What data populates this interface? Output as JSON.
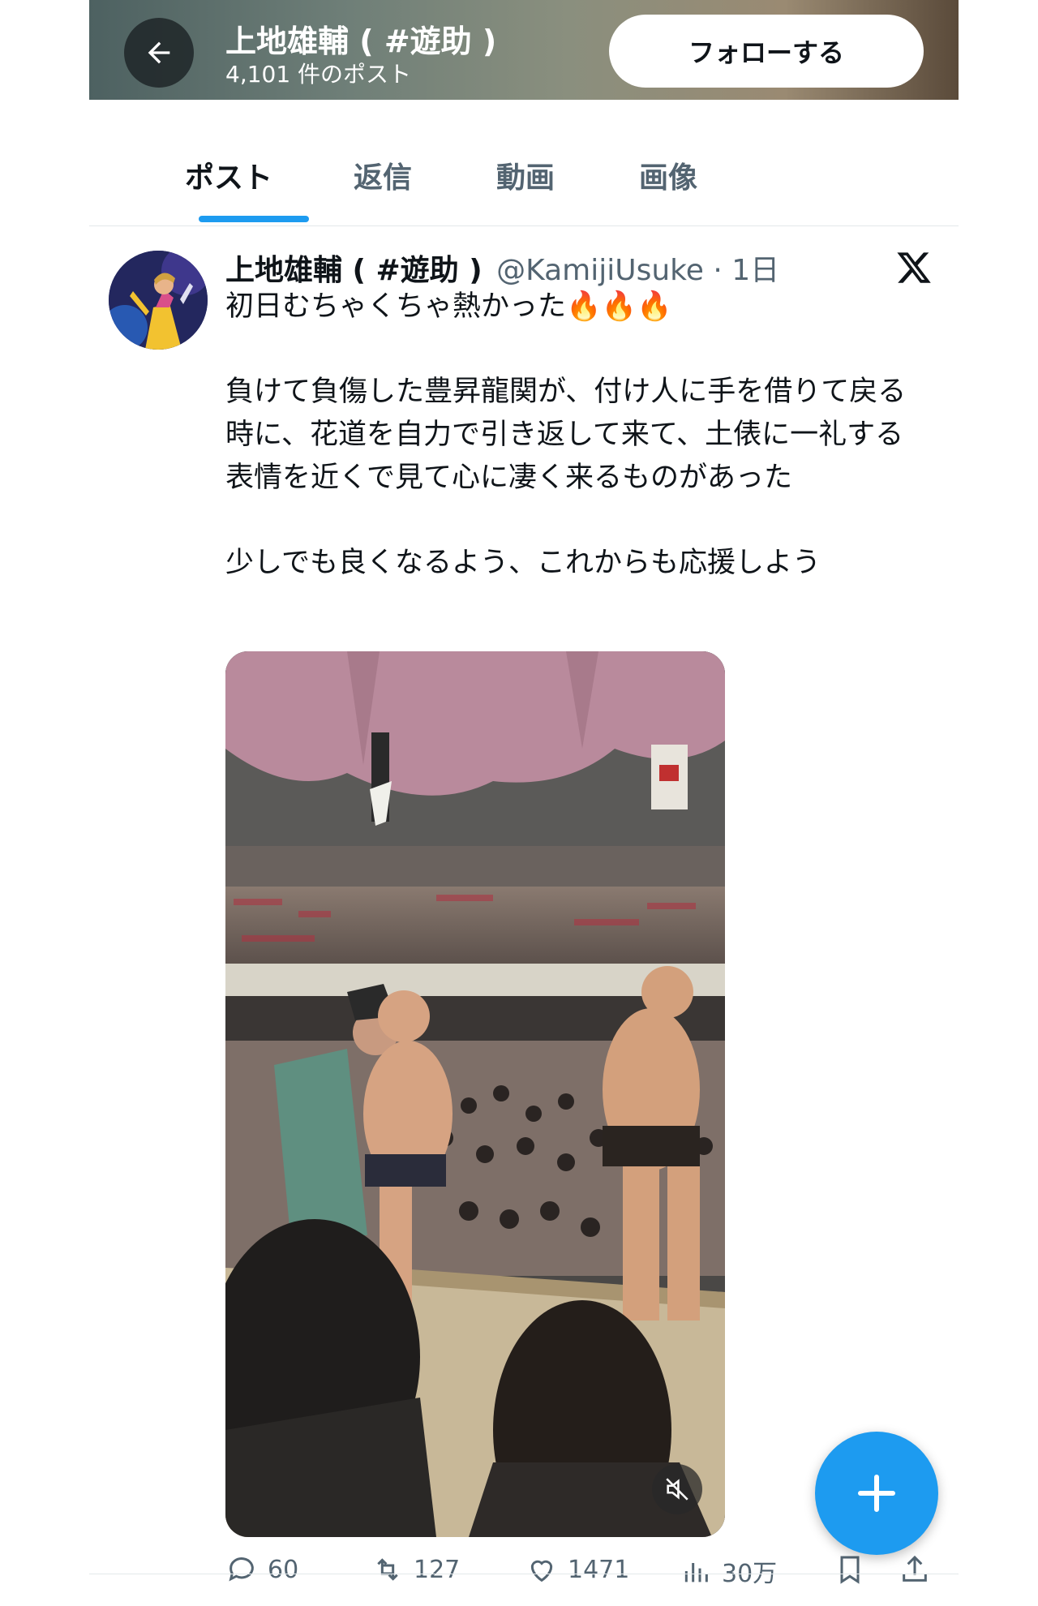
{
  "header": {
    "title": "上地雄輔 ( #遊助 )",
    "post_count": "4,101 件のポスト",
    "follow_label": "フォローする"
  },
  "tabs": [
    {
      "label": "ポスト",
      "active": true
    },
    {
      "label": "返信",
      "active": false
    },
    {
      "label": "動画",
      "active": false
    },
    {
      "label": "画像",
      "active": false
    }
  ],
  "post": {
    "display_name": "上地雄輔 ( #遊助 )",
    "handle_time": "@KamijiUsuke · 1日",
    "line1": "初日むちゃくちゃ熱かった",
    "flames": "🔥🔥🔥",
    "paragraph2": "負けて負傷した豊昇龍関が、付け人に手を借りて戻る時に、花道を自力で引き返して来て、土俵に一礼する表情を近くで見て心に凄く来るものがあった",
    "paragraph3": "少しでも良くなるよう、これからも応援しよう",
    "media_icon": "mute-icon"
  },
  "actions": {
    "replies": "60",
    "reposts": "127",
    "likes": "1471",
    "views": "30万"
  },
  "colors": {
    "accent": "#1d9bf0",
    "muted_text": "#536471"
  }
}
